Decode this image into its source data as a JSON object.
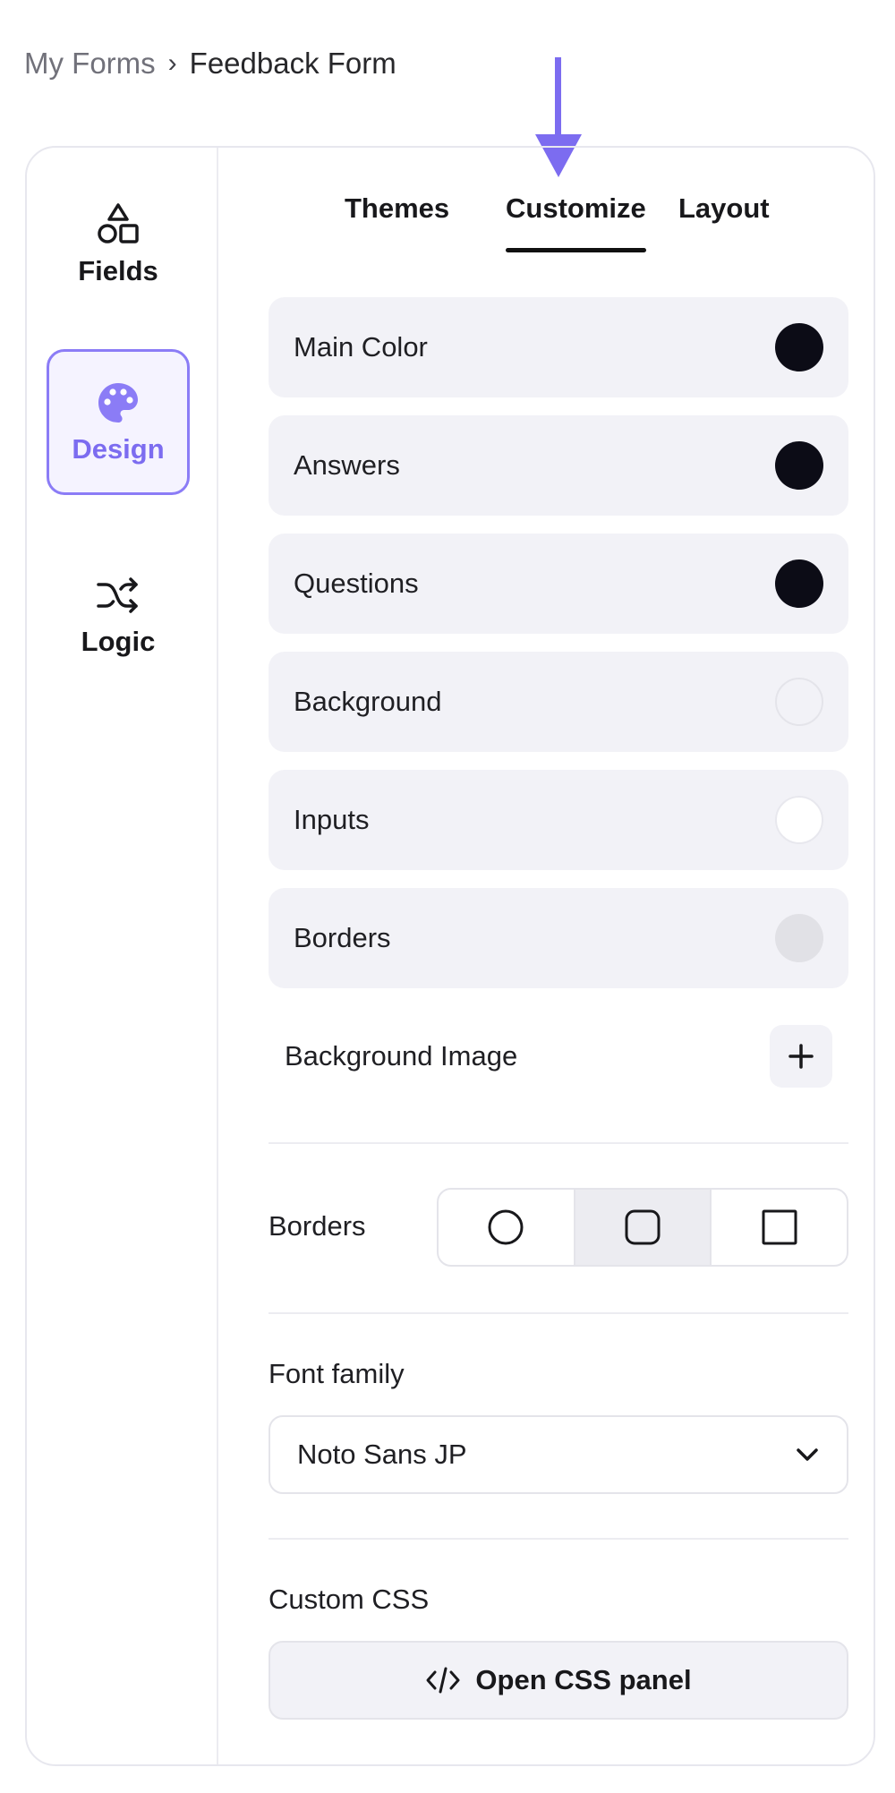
{
  "breadcrumb": {
    "parent": "My Forms",
    "separator": "›",
    "current": "Feedback Form"
  },
  "annotation": {
    "arrow_color": "#7c6cf0",
    "arrow_icon": "arrow-down-icon"
  },
  "sidebar": {
    "items": [
      {
        "label": "Fields",
        "icon": "shapes-icon",
        "active": false
      },
      {
        "label": "Design",
        "icon": "palette-icon",
        "active": true
      },
      {
        "label": "Logic",
        "icon": "shuffle-icon",
        "active": false
      }
    ],
    "active_color": "#7c6cf0"
  },
  "tabs": [
    {
      "label": "Themes",
      "active": false
    },
    {
      "label": "Customize",
      "active": true
    },
    {
      "label": "Layout",
      "active": false
    }
  ],
  "colors": [
    {
      "label": "Main Color",
      "value": "#0c0c16"
    },
    {
      "label": "Answers",
      "value": "#0c0c16"
    },
    {
      "label": "Questions",
      "value": "#0c0c16"
    },
    {
      "label": "Background",
      "value": "#f2f2f7"
    },
    {
      "label": "Inputs",
      "value": "#ffffff"
    },
    {
      "label": "Borders",
      "value": "#e1e1e6"
    }
  ],
  "background_image": {
    "label": "Background Image",
    "add_icon": "plus-icon"
  },
  "borders": {
    "label": "Borders",
    "options": [
      {
        "icon": "circle-shape-icon",
        "selected": false
      },
      {
        "icon": "rounded-square-icon",
        "selected": true
      },
      {
        "icon": "square-icon",
        "selected": false
      }
    ]
  },
  "font": {
    "label": "Font family",
    "value": "Noto Sans JP",
    "dropdown_icon": "chevron-down-icon"
  },
  "custom_css": {
    "label": "Custom CSS",
    "button_label": "Open CSS panel",
    "button_icon": "code-icon"
  }
}
